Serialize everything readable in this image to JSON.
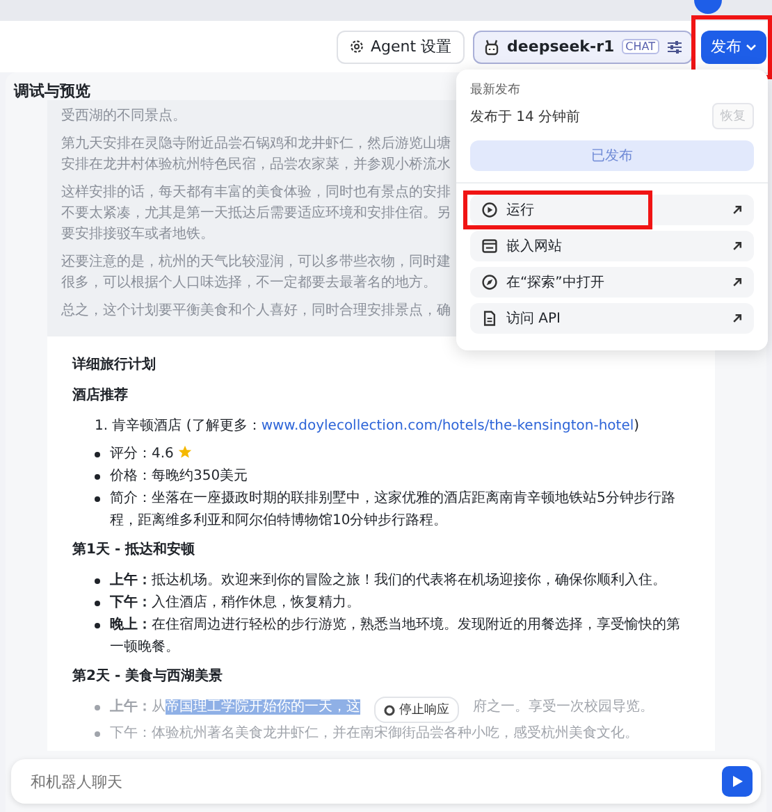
{
  "header": {
    "agent_settings": "Agent 设置",
    "model": {
      "name": "deepseek-r1",
      "badge": "CHAT"
    },
    "publish": {
      "label": "发布",
      "expanded": true,
      "highlighted": true
    }
  },
  "panel": {
    "title": "调试与预览"
  },
  "thinking": [
    {
      "lines": [
        "受西湖的不同景点。"
      ]
    },
    {
      "lines": [
        "第九天安排在灵隐寺附近品尝石锅鸡和龙井虾仁，然后游览山塘",
        "安排在龙井村体验杭州特色民宿，品尝农家菜，并参观小桥流水"
      ]
    },
    {
      "lines": [
        "这样安排的话，每天都有丰富的美食体验，同时也有景点的安排",
        "不要太紧凑，尤其是第一天抵达后需要适应环境和安排住宿。另",
        "要安排接驳车或者地铁。"
      ]
    },
    {
      "lines": [
        "还要注意的是，杭州的天气比较湿润，可以多带些衣物，同时建",
        "很多，可以根据个人口味选择，不一定都要去最著名的地方。"
      ]
    },
    {
      "lines": [
        "总之，这个计划要平衡美食和个人喜好，同时合理安排景点，确"
      ]
    }
  ],
  "answer": {
    "heading": "详细旅行计划",
    "hotel_heading": "酒店推荐",
    "hotel": {
      "number": "1.",
      "text": "肯辛顿酒店 (了解更多：",
      "link": "www.doylecollection.com/hotels/the-kensington-hotel",
      "close": ")"
    },
    "hotel_details": [
      {
        "kind": "rating",
        "text": "评分：4.6"
      },
      {
        "kind": "text",
        "text": "价格：每晚约350美元"
      },
      {
        "kind": "text",
        "text": "简介：坐落在一座摄政时期的联排别墅中，这家优雅的酒店距离南肯辛顿地铁站5分钟步行路程，距离维多利亚和阿尔伯特博物馆10分钟步行路程。"
      }
    ],
    "days": [
      {
        "title": "第1天 - 抵达和安顿",
        "items": [
          {
            "kind": "text",
            "text": "**上午：**抵达机场。欢迎来到你的冒险之旅！我们的代表将在机场迎接你，确保你顺利入住。"
          },
          {
            "kind": "text",
            "text": "**下午：**入住酒店，稍作休息，恢复精力。"
          },
          {
            "kind": "text",
            "text": "**晚上：**在住宿周边进行轻松的步行游览，熟悉当地环境。发现附近的用餐选择，享受愉快的第一顿晚餐。"
          }
        ]
      },
      {
        "title": "第2天 - 美食与西湖美景",
        "items": [
          {
            "kind": "selection",
            "lead": "上午：",
            "text": "从",
            "selected_text": "帝国理工学院开始你的一天，这",
            "after": "府之一。享受一次校园导览。"
          },
          {
            "kind": "faded",
            "text": "下午：体验杭州著名美食龙井虾仁，并在南宋御街品尝各种小吃，感受杭州美食文化。"
          }
        ]
      }
    ]
  },
  "stop_button": "停止响应",
  "composer": {
    "placeholder": "和机器人聊天"
  },
  "publish_menu": {
    "caption": "最新发布",
    "published_time": "发布于 14 分钟前",
    "restore": {
      "label": "恢复",
      "disabled": true
    },
    "status": {
      "label": "已发布",
      "disabled": true
    },
    "items": [
      {
        "kind": "run",
        "label": "运行",
        "highlighted": true
      },
      {
        "kind": "embed",
        "label": "嵌入网站",
        "highlighted": false
      },
      {
        "kind": "explore",
        "label": "在“探索”中打开",
        "highlighted": false
      },
      {
        "kind": "api",
        "label": "访问 API",
        "highlighted": false
      }
    ]
  }
}
